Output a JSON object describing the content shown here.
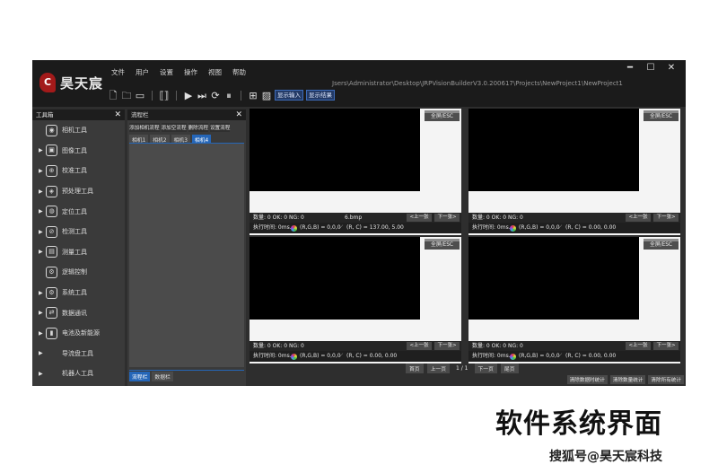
{
  "app": {
    "logo_text": "昊天宸",
    "logo_mark": "C",
    "menu": [
      "文件",
      "用户",
      "设置",
      "操作",
      "视图",
      "帮助"
    ],
    "path": "Jsers\\Administrator\\Desktop\\JRPVisionBuilderV3.0.200617\\Projects\\NewProject1\\NewProject1",
    "window_buttons": [
      "━",
      "☐",
      "✕"
    ],
    "toolbar": {
      "show_input": "显示输入",
      "show_result": "显示结果"
    }
  },
  "toolbox": {
    "title": "工具箱",
    "close": "✕",
    "items": [
      {
        "label": "相机工具",
        "icon": "camera-icon",
        "glyph": "◉",
        "expandable": false
      },
      {
        "label": "图像工具",
        "icon": "image-icon",
        "glyph": "▣",
        "expandable": true
      },
      {
        "label": "校准工具",
        "icon": "calibrate-icon",
        "glyph": "⊕",
        "expandable": true
      },
      {
        "label": "预处理工具",
        "icon": "preprocess-icon",
        "glyph": "◈",
        "expandable": true
      },
      {
        "label": "定位工具",
        "icon": "locate-icon",
        "glyph": "◍",
        "expandable": true
      },
      {
        "label": "检测工具",
        "icon": "inspect-icon",
        "glyph": "⊘",
        "expandable": true
      },
      {
        "label": "测量工具",
        "icon": "measure-icon",
        "glyph": "▤",
        "expandable": true
      },
      {
        "label": "逻辑控制",
        "icon": "logic-icon",
        "glyph": "⚙",
        "expandable": false
      },
      {
        "label": "系统工具",
        "icon": "system-icon",
        "glyph": "⚙",
        "expandable": true
      },
      {
        "label": "数据通讯",
        "icon": "comm-icon",
        "glyph": "⇄",
        "expandable": true
      },
      {
        "label": "电池及新能源",
        "icon": "battery-icon",
        "glyph": "▮",
        "expandable": true
      },
      {
        "label": "导流盘工具",
        "icon": "disk-icon",
        "glyph": "",
        "expandable": true
      },
      {
        "label": "机器人工具",
        "icon": "robot-icon",
        "glyph": "",
        "expandable": true
      }
    ]
  },
  "flow": {
    "title": "流程栏",
    "close": "✕",
    "actions": [
      "添加相机流程",
      "添加空流程",
      "删除流程",
      "设置流程"
    ],
    "tabs": [
      "相机1",
      "相机2",
      "相机3",
      "相机4"
    ],
    "active_tab": 3,
    "bottom_tabs": [
      "流程栏",
      "数据栏"
    ]
  },
  "panes": [
    {
      "full": "全屏/ESC",
      "stats": "数量: 0  OK: 0  NG: 0",
      "fname": "6.bmp",
      "prev": "<上一张",
      "next": "下一张>",
      "exec": "执行时间: 0ms.",
      "rgb": "(R,G,B) = 0,0,0",
      "rc": "(R, C) = 137.00, 5.00"
    },
    {
      "full": "全屏/ESC",
      "stats": "数量: 0  OK: 0  NG: 0",
      "fname": "",
      "prev": "<上一张",
      "next": "下一张>",
      "exec": "执行时间: 0ms.",
      "rgb": "(R,G,B) = 0,0,0",
      "rc": "(R, C) = 0.00, 0.00"
    },
    {
      "full": "全屏/ESC",
      "stats": "数量: 0  OK: 0  NG: 0",
      "fname": "",
      "prev": "<上一张",
      "next": "下一张>",
      "exec": "执行时间: 0ms.",
      "rgb": "(R,G,B) = 0,0,0",
      "rc": "(R, C) = 0.00, 0.00"
    },
    {
      "full": "全屏/ESC",
      "stats": "数量: 0  OK: 0  NG: 0",
      "fname": "",
      "prev": "<上一张",
      "next": "下一张>",
      "exec": "执行时间: 0ms.",
      "rgb": "(R,G,B) = 0,0,0",
      "rc": "(R, C) = 0.00, 0.00"
    }
  ],
  "pager": {
    "first": "首页",
    "prev": "上一页",
    "info": "1 / 1",
    "next": "下一页",
    "last": "尾页"
  },
  "bottom_buttons": [
    "清除数据时统计",
    "清除数量统计",
    "清除所有统计"
  ],
  "caption": "软件系统界面",
  "watermark": "搜狐号@昊天宸科技",
  "colors": {
    "accent": "#2566b8",
    "dark_bg": "#2e2e2e",
    "panel_bg": "#3a3a3a"
  }
}
